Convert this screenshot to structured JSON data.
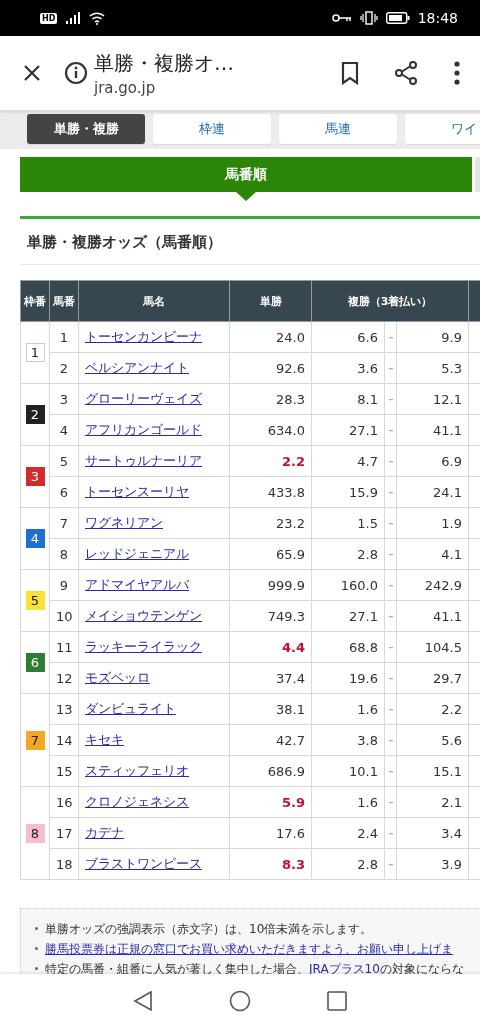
{
  "status_bar": {
    "network": "HD",
    "time": "18:48"
  },
  "browser": {
    "title": "単勝・複勝オ…",
    "url": "jra.go.jp"
  },
  "bet_tabs": [
    {
      "label": "単勝・複勝",
      "selected": true
    },
    {
      "label": "枠連",
      "selected": false
    },
    {
      "label": "馬連",
      "selected": false
    },
    {
      "label": "ワイ",
      "selected": false
    }
  ],
  "sort_tab": {
    "label": "馬番順",
    "selected": true
  },
  "heading": "単勝・複勝オッズ（馬番順）",
  "table": {
    "columns": [
      "枠番",
      "馬番",
      "馬名",
      "単勝",
      "複勝（3着払い）"
    ],
    "frames": [
      {
        "number": "1",
        "color": "#ffffff",
        "horses": [
          {
            "number": "1",
            "name": "トーセンカンビーナ",
            "win": "24.0",
            "highlighted": false,
            "place_min": "6.6",
            "place_max": "9.9"
          },
          {
            "number": "2",
            "name": "ペルシアンナイト",
            "win": "92.6",
            "highlighted": false,
            "place_min": "3.6",
            "place_max": "5.3"
          }
        ]
      },
      {
        "number": "2",
        "color": "#222222",
        "horses": [
          {
            "number": "3",
            "name": "グローリーヴェイズ",
            "win": "28.3",
            "highlighted": false,
            "place_min": "8.1",
            "place_max": "12.1"
          },
          {
            "number": "4",
            "name": "アフリカンゴールド",
            "win": "634.0",
            "highlighted": false,
            "place_min": "27.1",
            "place_max": "41.1"
          }
        ]
      },
      {
        "number": "3",
        "color": "#d22b2b",
        "horses": [
          {
            "number": "5",
            "name": "サートゥルナーリア",
            "win": "2.2",
            "highlighted": true,
            "place_min": "4.7",
            "place_max": "6.9"
          },
          {
            "number": "6",
            "name": "トーセンスーリヤ",
            "win": "433.8",
            "highlighted": false,
            "place_min": "15.9",
            "place_max": "24.1"
          }
        ]
      },
      {
        "number": "4",
        "color": "#1e6fcf",
        "horses": [
          {
            "number": "7",
            "name": "ワグネリアン",
            "win": "23.2",
            "highlighted": false,
            "place_min": "1.5",
            "place_max": "1.9"
          },
          {
            "number": "8",
            "name": "レッドジェニアル",
            "win": "65.9",
            "highlighted": false,
            "place_min": "2.8",
            "place_max": "4.1"
          }
        ]
      },
      {
        "number": "5",
        "color": "#f8e23a",
        "horses": [
          {
            "number": "9",
            "name": "アドマイヤアルバ",
            "win": "999.9",
            "highlighted": false,
            "place_min": "160.0",
            "place_max": "242.9"
          },
          {
            "number": "10",
            "name": "メイショウテンゲン",
            "win": "749.3",
            "highlighted": false,
            "place_min": "27.1",
            "place_max": "41.1"
          }
        ]
      },
      {
        "number": "6",
        "color": "#2e7d32",
        "horses": [
          {
            "number": "11",
            "name": "ラッキーライラック",
            "win": "4.4",
            "highlighted": true,
            "place_min": "68.8",
            "place_max": "104.5"
          },
          {
            "number": "12",
            "name": "モズベッロ",
            "win": "37.4",
            "highlighted": false,
            "place_min": "19.6",
            "place_max": "29.7"
          }
        ]
      },
      {
        "number": "7",
        "color": "#f5a623",
        "horses": [
          {
            "number": "13",
            "name": "ダンビュライト",
            "win": "38.1",
            "highlighted": false,
            "place_min": "1.6",
            "place_max": "2.2"
          },
          {
            "number": "14",
            "name": "キセキ",
            "win": "42.7",
            "highlighted": false,
            "place_min": "3.8",
            "place_max": "5.6"
          },
          {
            "number": "15",
            "name": "スティッフェリオ",
            "win": "686.9",
            "highlighted": false,
            "place_min": "10.1",
            "place_max": "15.1"
          }
        ]
      },
      {
        "number": "8",
        "color": "#f7bcd0",
        "horses": [
          {
            "number": "16",
            "name": "クロノジェネシス",
            "win": "5.9",
            "highlighted": true,
            "place_min": "1.6",
            "place_max": "2.1"
          },
          {
            "number": "17",
            "name": "カデナ",
            "win": "17.6",
            "highlighted": false,
            "place_min": "2.4",
            "place_max": "3.4"
          },
          {
            "number": "18",
            "name": "ブラストワンピース",
            "win": "8.3",
            "highlighted": true,
            "place_min": "2.8",
            "place_max": "3.9"
          }
        ]
      }
    ]
  },
  "notes": [
    {
      "segments": [
        {
          "text": "単勝オッズの強調表示（赤文字）は、10倍未満を示します。",
          "link": false
        }
      ]
    },
    {
      "segments": [
        {
          "text": "勝馬投票券は正規の窓口でお買い求めいただきますよう、お願い申し上げま",
          "link": true
        }
      ]
    },
    {
      "segments": [
        {
          "text": "特定の馬番・組番に人気が著しく集中した場合、",
          "link": false
        },
        {
          "text": "JRAプラス10",
          "link": true
        },
        {
          "text": "の対象にならな",
          "link": false
        }
      ]
    }
  ]
}
